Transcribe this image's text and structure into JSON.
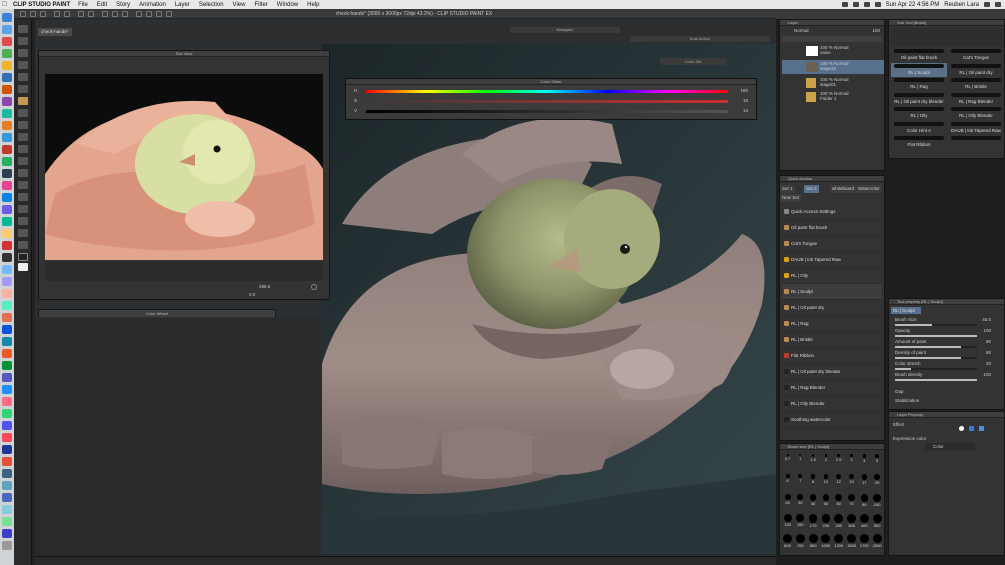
{
  "menubar": {
    "app_name": "CLIP STUDIO PAINT",
    "items": [
      "File",
      "Edit",
      "Story",
      "Animation",
      "Layer",
      "Selection",
      "View",
      "Filter",
      "Window",
      "Help"
    ],
    "datetime": "Sun Apr 22  4:56 PM",
    "user": "Reuben Lara"
  },
  "window": {
    "title": "check-hands* (3000 x 3000px 72dpi 43.3%)  - CLIP STUDIO PAINT EX",
    "doc_tab": "check-hands*"
  },
  "palettes": {
    "sub_view": "Sub View",
    "navigator": "Navigator",
    "auto_action": "Auto Action",
    "color_set": "Color Set",
    "color_slider": "Color Slider",
    "color_wheel": "Color Wheel",
    "layer": "Layer",
    "quick_access": "Quick Access",
    "brush_size": "Brush size [RL | Sculpt]",
    "sub_tool": "Sub Tool [Brush]",
    "tool_property": "Tool property [RL | Sculpt]",
    "layer_property": "Layer Property"
  },
  "subview": {
    "zoom": "298.5",
    "angle": "0.0"
  },
  "color_slider": {
    "rows": [
      {
        "label": "H",
        "value": "180"
      },
      {
        "label": "S",
        "value": "10"
      },
      {
        "label": "V",
        "value": "14"
      }
    ]
  },
  "layer_panel": {
    "blend_mode": "Normal",
    "opacity": "100",
    "layers": [
      {
        "line1": "100 % Normal",
        "line2": "value"
      },
      {
        "line1": "100 % Normal",
        "line2": "stage22"
      },
      {
        "line1": "100 % Normal",
        "line2": "stage01"
      },
      {
        "line1": "100 % Normal",
        "line2": "Folder 1"
      }
    ]
  },
  "quick_access": {
    "tabs": [
      "Set 1",
      "Set 2",
      "whiteboard",
      "Watercolor",
      "New Set"
    ],
    "items": [
      "Quick Access Settings",
      "Oil paint flat brush",
      "Cat's Tongue",
      "DAUB | Ink Tapered Raw",
      "RL | Oily",
      "RL | Sculpt",
      "RL | Oil paint dry",
      "RL | Rag",
      "RL | Bristle",
      "Flat Ribbon",
      "RL | Oil paint dry blender",
      "RL | Rag Blender",
      "RL | Oily Blender",
      "Soothing watercolor"
    ]
  },
  "brush_size": {
    "values": [
      "0.7",
      "1",
      "1.5",
      "2",
      "2.5",
      "3",
      "4",
      "5",
      "6",
      "7",
      "8",
      "10",
      "12",
      "15",
      "17",
      "20",
      "25",
      "30",
      "40",
      "50",
      "60",
      "70",
      "80",
      "100",
      "120",
      "150",
      "170",
      "200",
      "250",
      "300",
      "400",
      "500",
      "600",
      "700",
      "800",
      "1000",
      "1200",
      "1500",
      "1700",
      "2000"
    ]
  },
  "sub_tool": {
    "items": [
      "Oil paint flat brush",
      "Cat's Tongue",
      "RL | Sculpt",
      "RL | Oil paint dry",
      "RL | Rag",
      "RL | Bristle",
      "RL | Oil paint dry blender",
      "RL | Rag Blender",
      "RL | Oily",
      "RL | Oily Blender",
      "Color Hint A",
      "DAUB | Ink Tapered Raw",
      "Flat Ribbon",
      ""
    ]
  },
  "tool_property": {
    "name": "RL | Sculpt",
    "rows": [
      {
        "label": "Brush Size",
        "value": "45.0",
        "fill": 0.45
      },
      {
        "label": "Opacity",
        "value": "100",
        "fill": 1.0
      },
      {
        "label": "Amount of paint",
        "value": "80",
        "fill": 0.8
      },
      {
        "label": "Density of paint",
        "value": "80",
        "fill": 0.8
      },
      {
        "label": "Color stretch",
        "value": "20",
        "fill": 0.2
      },
      {
        "label": "Brush density",
        "value": "100",
        "fill": 1.0
      }
    ],
    "gap": "Gap",
    "stabilization": "Stabilization"
  },
  "layer_property": {
    "effect": "Effect",
    "expression_color": "Expression color",
    "color_mode": "Color"
  }
}
